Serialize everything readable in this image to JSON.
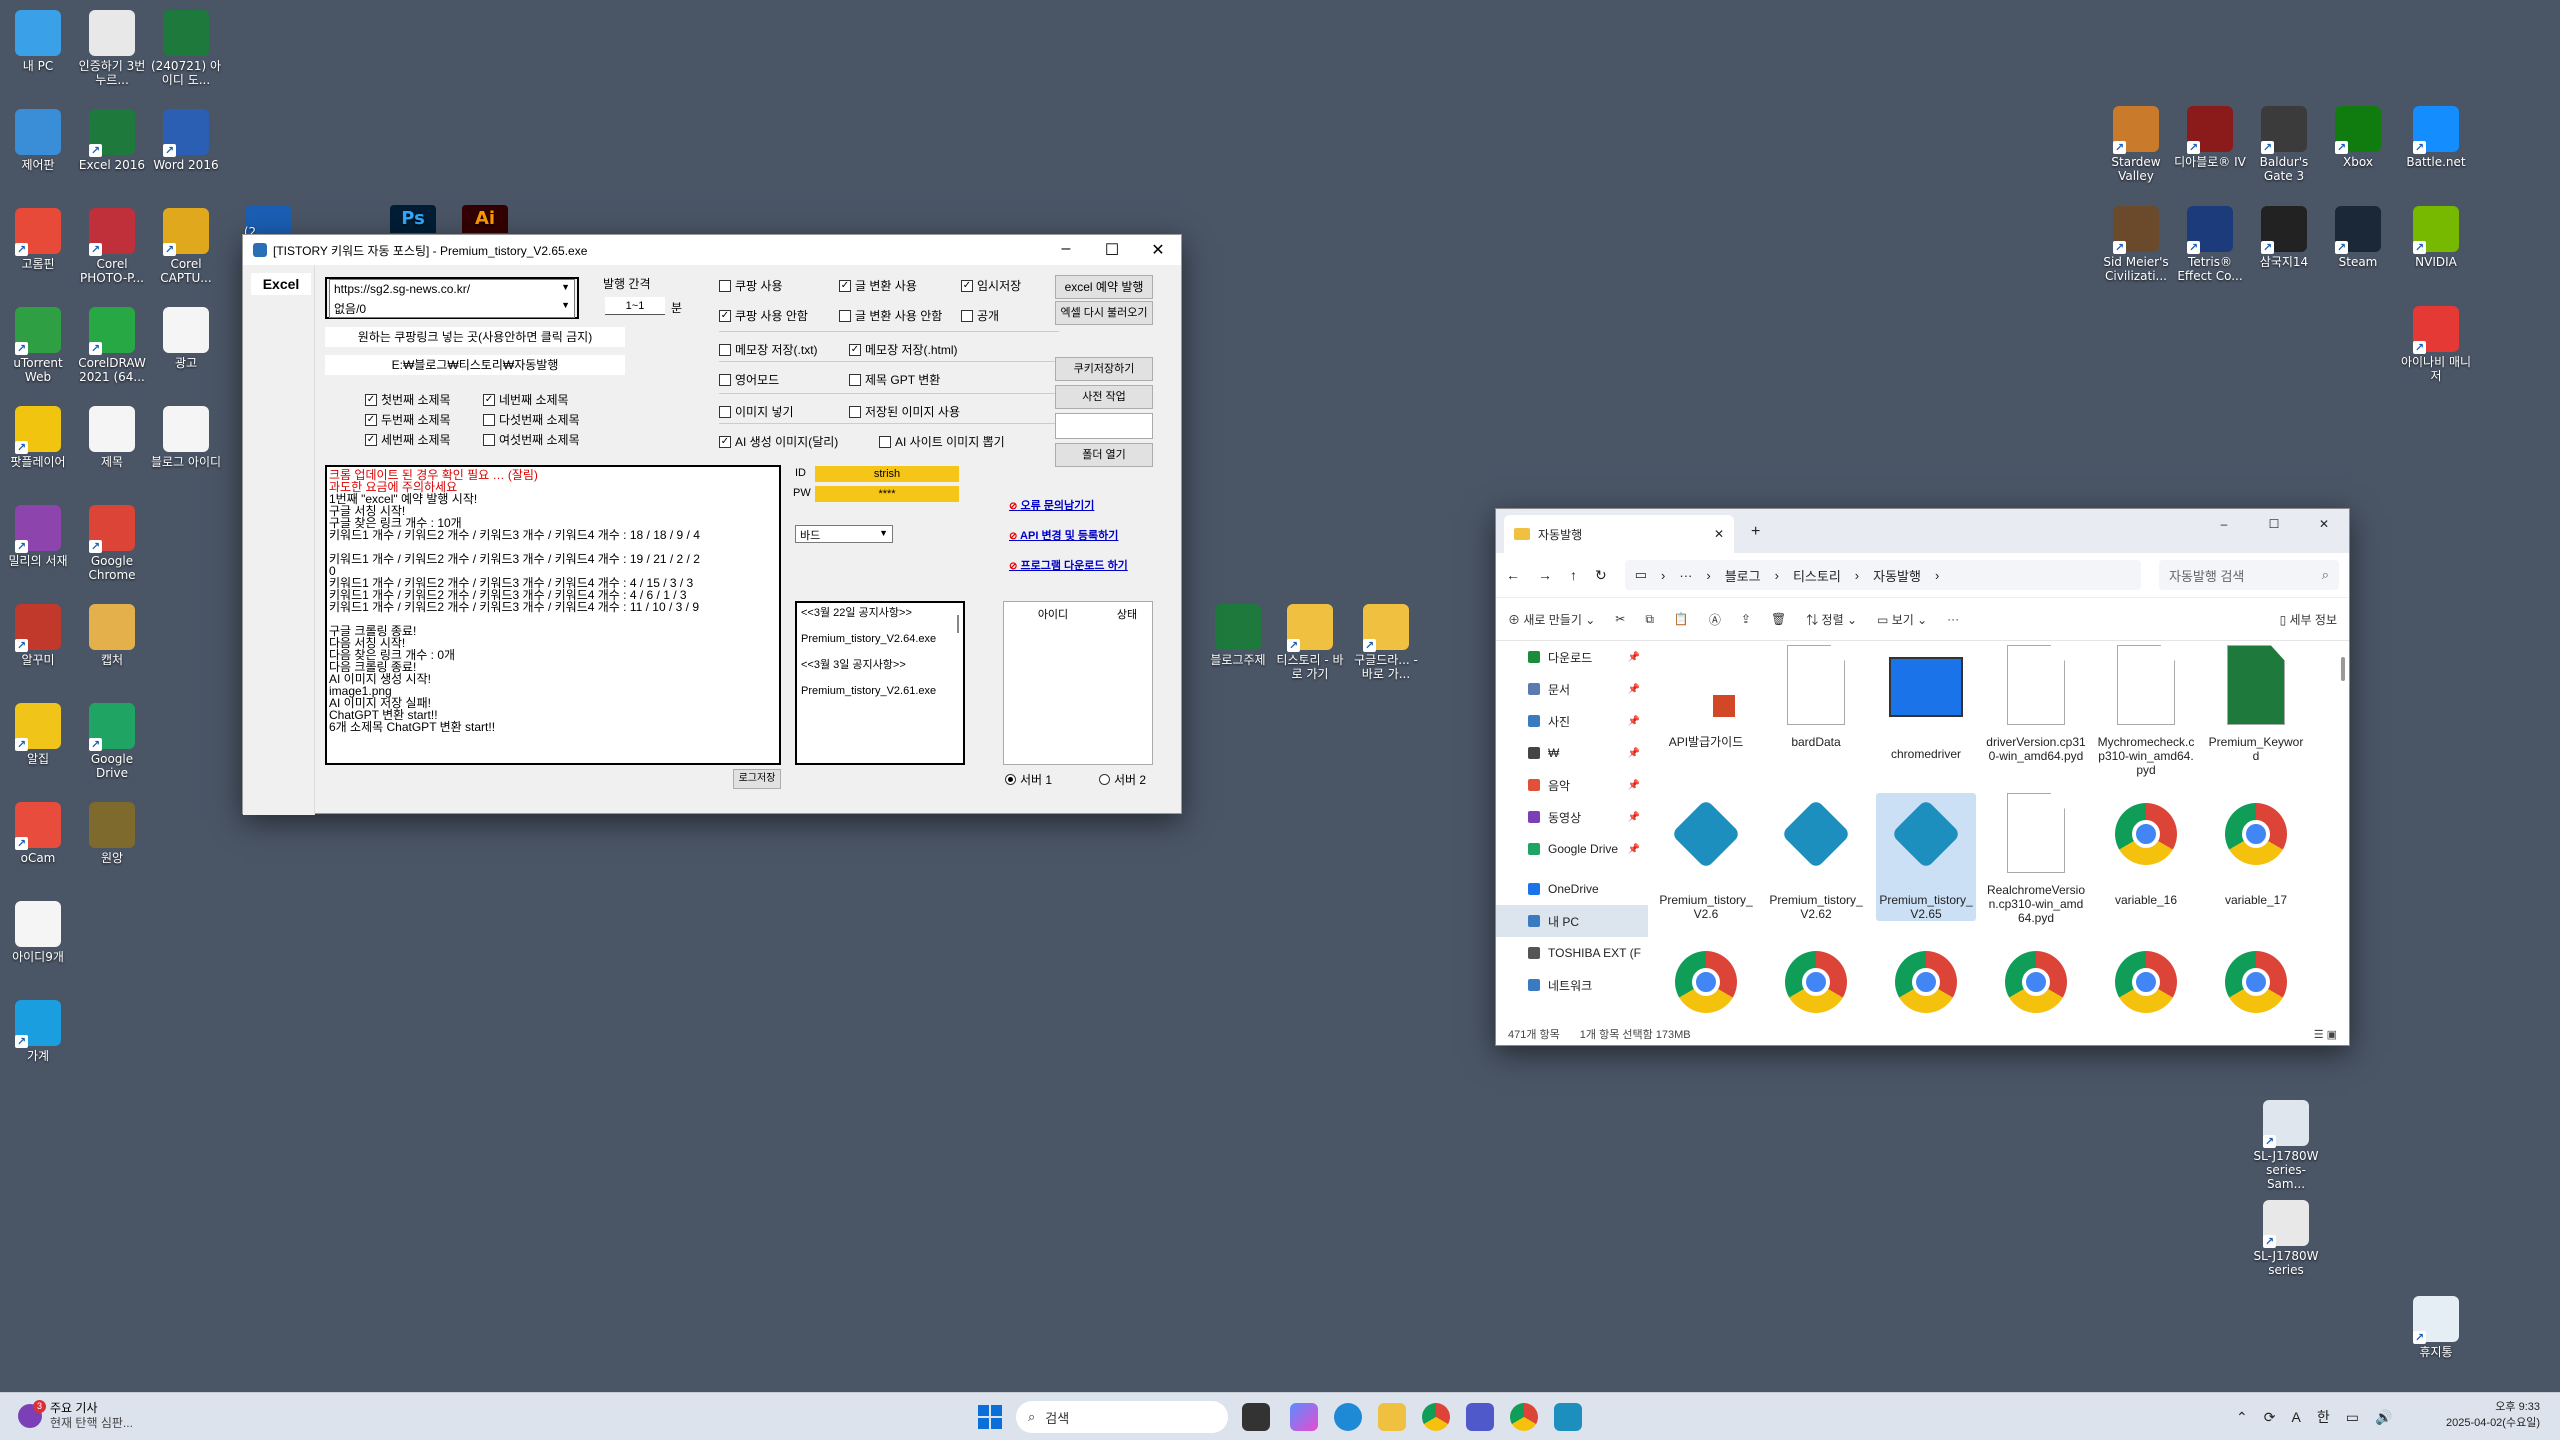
{
  "desktop": {
    "left_icons": [
      {
        "label": "내 PC",
        "color": "#3aa0e8",
        "shortcut": false
      },
      {
        "label": "인증하기 3번누르...",
        "color": "#e8e8e8",
        "shortcut": false
      },
      {
        "label": "(240721) 아이디 도...",
        "color": "#1e7a3c",
        "shortcut": false
      },
      {
        "label": "제어판",
        "color": "#3a8ed8",
        "shortcut": false
      },
      {
        "label": "Excel 2016",
        "color": "#1e7a3c",
        "shortcut": true
      },
      {
        "label": "Word 2016",
        "color": "#2b5fb4",
        "shortcut": true
      },
      {
        "label": "고롬핀",
        "color": "#e84a3a",
        "shortcut": true
      },
      {
        "label": "Corel PHOTO-P...",
        "color": "#c0303a",
        "shortcut": true
      },
      {
        "label": "Corel CAPTU...",
        "color": "#e0a81c",
        "shortcut": true
      },
      {
        "label": "uTorrent Web",
        "color": "#2ea043",
        "shortcut": true
      },
      {
        "label": "CorelDRAW 2021 (64...",
        "color": "#28a745",
        "shortcut": true
      },
      {
        "label": "광고",
        "color": "#f5f5f5",
        "shortcut": false
      },
      {
        "label": "팟플레이어",
        "color": "#f1c40f",
        "shortcut": true
      },
      {
        "label": "제목",
        "color": "#f5f5f5",
        "shortcut": false
      },
      {
        "label": "블로그 아이디",
        "color": "#f5f5f5",
        "shortcut": false
      },
      {
        "label": "밀리의 서재",
        "color": "#8e44ad",
        "shortcut": true
      },
      {
        "label": "Google Chrome",
        "color": "#db4437",
        "shortcut": true
      },
      {
        "label": "알꾸미",
        "color": "#c0392b",
        "shortcut": true
      },
      {
        "label": "캡처",
        "color": "#e3b04b",
        "shortcut": false
      },
      {
        "label": "알집",
        "color": "#f0c419",
        "shortcut": true
      },
      {
        "label": "Google Drive",
        "color": "#1fa463",
        "shortcut": true
      },
      {
        "label": "oCam",
        "color": "#e74c3c",
        "shortcut": true
      },
      {
        "label": "원앙",
        "color": "#7f6a2e",
        "shortcut": false
      },
      {
        "label": "아이디9개",
        "color": "#f5f5f5",
        "shortcut": false
      },
      {
        "label": "가계",
        "color": "#1a9ee0",
        "shortcut": true
      }
    ],
    "right_icons": [
      {
        "label": "Stardew Valley",
        "color": "#c97a2b"
      },
      {
        "label": "디아블로® IV",
        "color": "#8b1a1a"
      },
      {
        "label": "Baldur's Gate 3",
        "color": "#3b3b3b"
      },
      {
        "label": "Xbox",
        "color": "#107c10"
      },
      {
        "label": "Battle.net",
        "color": "#148eff"
      },
      {
        "label": "Sid Meier's Civilizati...",
        "color": "#6b4a2b"
      },
      {
        "label": "Tetris® Effect Co...",
        "color": "#1b3b7a"
      },
      {
        "label": "삼국지14",
        "color": "#222222"
      },
      {
        "label": "Steam",
        "color": "#1b2838"
      },
      {
        "label": "NVIDIA",
        "color": "#76b900"
      },
      {
        "label": "아이나비 매니저",
        "color": "#e53935"
      },
      {
        "label": "SL-J1780W series-Sam...",
        "color": "#dfe6ee"
      },
      {
        "label": "SL-J1780W series",
        "color": "#e8e8e8"
      },
      {
        "label": "휴지통",
        "color": "#e6eef5"
      }
    ],
    "middle_icons": [
      {
        "label": "블로그주제",
        "color": "#1e7a3c"
      },
      {
        "label": "티스토리 - 바로 가기",
        "color": "#f0c040"
      },
      {
        "label": "구글드라... - 바로 가...",
        "color": "#f0c040"
      }
    ],
    "partial_icon_label": "(2"
  },
  "app": {
    "title": "[TISTORY 키워드 자동 포스팅] - Premium_tistory_V2.65.exe",
    "tab_label": "Excel",
    "url_combo": "https://sg2.sg-news.co.kr/",
    "none_combo": "없음/0",
    "coupang_placeholder": "원하는 쿠팡링크 넣는 곳(사용안하면 클릭 금지)",
    "path_value": "E:₩블로그₩티스토리₩자동발행",
    "interval_label": "발행 간격",
    "interval_value": "1~1",
    "interval_unit": "분",
    "subheads": [
      {
        "label": "첫번째 소제목",
        "checked": true
      },
      {
        "label": "네번째 소제목",
        "checked": true
      },
      {
        "label": "두번째 소제목",
        "checked": true
      },
      {
        "label": "다섯번째 소제목",
        "checked": false
      },
      {
        "label": "세번째 소제목",
        "checked": true
      },
      {
        "label": "여섯번째 소제목",
        "checked": false
      }
    ],
    "options": [
      {
        "label": "쿠팡 사용",
        "checked": false
      },
      {
        "label": "글 변환 사용",
        "checked": true
      },
      {
        "label": "임시저장",
        "checked": true
      },
      {
        "label": "쿠팡 사용 안함",
        "checked": true
      },
      {
        "label": "글 변환 사용 안함",
        "checked": false
      },
      {
        "label": "공개",
        "checked": false
      },
      {
        "label": "메모장 저장(.txt)",
        "checked": false
      },
      {
        "label": "메모장 저장(.html)",
        "checked": true
      },
      {
        "label": "영어모드",
        "checked": false
      },
      {
        "label": "제목 GPT 변환",
        "checked": false
      },
      {
        "label": "이미지 넣기",
        "checked": false
      },
      {
        "label": "저장된 이미지 사용",
        "checked": false
      },
      {
        "label": "AI 생성 이미지(달리)",
        "checked": true
      },
      {
        "label": "AI 사이트 이미지 뽑기",
        "checked": false
      }
    ],
    "buttons": {
      "excel_reserve": "excel 예약 발행",
      "excel_reload": "엑셀 다시 불러오기",
      "cookie_save": "쿠키저장하기",
      "dictionary": "사전 작업",
      "open_folder": "폴더 열기",
      "log_save": "로그저장"
    },
    "log_lines": [
      {
        "text": "크롬 업데이트 된 경우 확인 필요 … (잘림)",
        "red": true
      },
      {
        "text": "과도한 요금에 주의하세요",
        "red": true
      },
      {
        "text": "1번째 \"excel\" 예약 발행 시작!",
        "red": false
      },
      {
        "text": "구글 서칭 시작!",
        "red": false
      },
      {
        "text": "구글 찾은 링크 개수 : 10개",
        "red": false
      },
      {
        "text": "키워드1 개수 / 키워드2 개수 / 키워드3 개수 / 키워드4 개수 : 18 / 18 / 9 / 4",
        "red": false
      },
      {
        "text": "",
        "red": false
      },
      {
        "text": "키워드1 개수 / 키워드2 개수 / 키워드3 개수 / 키워드4 개수 : 19 / 21 / 2 / 2",
        "red": false
      },
      {
        "text": "0",
        "red": false
      },
      {
        "text": "키워드1 개수 / 키워드2 개수 / 키워드3 개수 / 키워드4 개수 : 4 / 15 / 3 / 3",
        "red": false
      },
      {
        "text": "키워드1 개수 / 키워드2 개수 / 키워드3 개수 / 키워드4 개수 : 4 / 6 / 1 / 3",
        "red": false
      },
      {
        "text": "키워드1 개수 / 키워드2 개수 / 키워드3 개수 / 키워드4 개수 : 11 / 10 / 3 / 9",
        "red": false
      },
      {
        "text": "",
        "red": false
      },
      {
        "text": "구글 크롤링 종료!",
        "red": false
      },
      {
        "text": "다음 서칭 시작!",
        "red": false
      },
      {
        "text": "다음 찾은 링크 개수 : 0개",
        "red": false
      },
      {
        "text": "다음 크롤링 종료!",
        "red": false
      },
      {
        "text": "AI 이미지 생성 시작!",
        "red": false
      },
      {
        "text": "image1.png",
        "red": false
      },
      {
        "text": "AI 이미지 저장 실패!",
        "red": false
      },
      {
        "text": "ChatGPT 변환 start!!",
        "red": false
      },
      {
        "text": "6개 소제목 ChatGPT 변환 start!!",
        "red": false
      }
    ],
    "id_label": "ID",
    "id_value": "strish",
    "pw_label": "PW",
    "pw_value": "****",
    "band_combo": "바드",
    "links": [
      "오류 문의남기기",
      "API 변경 및 등록하기",
      "프로그램 다운로드 하기"
    ],
    "notices": [
      "<<3월 22일 공지사항>>",
      "",
      "Premium_tistory_V2.64.exe",
      "",
      "<<3월 3일 공지사항>>",
      "",
      "Premium_tistory_V2.61.exe"
    ],
    "table_headers": [
      "아이디",
      "상태"
    ],
    "servers": [
      {
        "label": "서버 1",
        "selected": true
      },
      {
        "label": "서버 2",
        "selected": false
      }
    ],
    "accent_yellow": "#f5c518"
  },
  "explorer": {
    "tab_title": "자동발행",
    "breadcrumb": [
      "블로그",
      "티스토리",
      "자동발행"
    ],
    "search_placeholder": "자동발행 검색",
    "commands": [
      "새로 만들기",
      "정렬",
      "보기",
      "세부 정보"
    ],
    "nav": [
      {
        "label": "다운로드",
        "pinned": true,
        "selected": false
      },
      {
        "label": "문서",
        "pinned": true,
        "selected": false
      },
      {
        "label": "사진",
        "pinned": true,
        "selected": false
      },
      {
        "label": "₩",
        "pinned": true,
        "selected": false
      },
      {
        "label": "음악",
        "pinned": true,
        "selected": false
      },
      {
        "label": "동영상",
        "pinned": true,
        "selected": false
      },
      {
        "label": "Google Drive",
        "pinned": true,
        "selected": false
      },
      {
        "label": "OneDrive",
        "pinned": false,
        "selected": false
      },
      {
        "label": "내 PC",
        "pinned": false,
        "selected": true
      },
      {
        "label": "TOSHIBA EXT (F",
        "pinned": false,
        "selected": false
      },
      {
        "label": "네트워크",
        "pinned": false,
        "selected": false
      }
    ],
    "files": [
      {
        "name": "API발급가이드",
        "kind": "ppt"
      },
      {
        "name": "bardData",
        "kind": "doc"
      },
      {
        "name": "chromedriver",
        "kind": "app"
      },
      {
        "name": "driverVersion.cp310-win_amd64.pyd",
        "kind": "doc"
      },
      {
        "name": "Mychromecheck.cp310-win_amd64.pyd",
        "kind": "doc"
      },
      {
        "name": "Premium_Keyword",
        "kind": "xls"
      },
      {
        "name": "Premium_tistory_V2.6",
        "kind": "gear"
      },
      {
        "name": "Premium_tistory_V2.62",
        "kind": "gear"
      },
      {
        "name": "Premium_tistory_V2.65",
        "kind": "gear"
      },
      {
        "name": "RealchromeVersion.cp310-win_amd64.pyd",
        "kind": "doc"
      },
      {
        "name": "variable_16",
        "kind": "chrome"
      },
      {
        "name": "variable_17",
        "kind": "chrome"
      },
      {
        "name": "",
        "kind": "chrome"
      },
      {
        "name": "",
        "kind": "chrome"
      },
      {
        "name": "",
        "kind": "chrome"
      },
      {
        "name": "",
        "kind": "chrome"
      },
      {
        "name": "",
        "kind": "chrome"
      },
      {
        "name": "",
        "kind": "chrome"
      }
    ],
    "selected_file": "Premium_tistory_V2.65",
    "status_count": "471개 항목",
    "status_selected": "1개 항목 선택함 173MB"
  },
  "taskbar": {
    "news_title": "주요 기사",
    "news_sub": "현재 탄핵 심판...",
    "news_badge": "3",
    "search_placeholder": "검색",
    "clock_time": "오후 9:33",
    "clock_date": "2025-04-02(수요일)",
    "tray_lang": "한",
    "tray_a": "A"
  }
}
